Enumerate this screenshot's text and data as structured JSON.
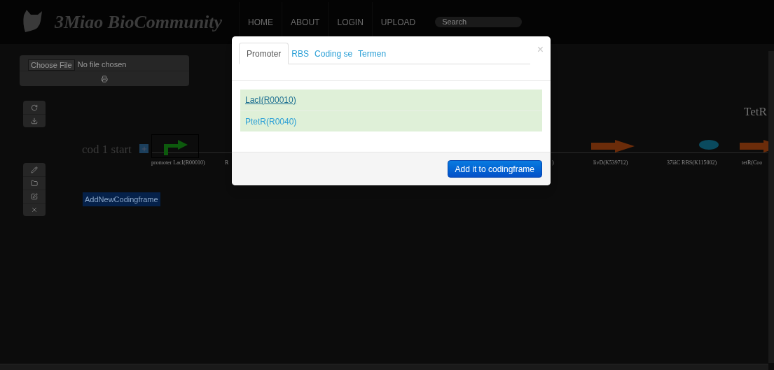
{
  "navbar": {
    "logo": "3Miao BioCommunity",
    "links": [
      "HOME",
      "ABOUT",
      "LOGIN",
      "UPLOAD"
    ],
    "search": {
      "placeholder": "Search"
    }
  },
  "file_panel": {
    "button": "Choose File",
    "status": "No file chosen"
  },
  "canvas": {
    "frame_title": "cod 1 start",
    "side_title": "TetR",
    "parts": [
      {
        "kind": "promoter",
        "label": "promoter LacI(R00010)"
      },
      {
        "kind": "label",
        "label": "R"
      },
      {
        "kind": "label",
        "label": ")"
      },
      {
        "kind": "cds",
        "label": "livD(K539712)"
      },
      {
        "kind": "rbs",
        "label": "37iâC RBS(K115002)"
      },
      {
        "kind": "cds",
        "label": "tetR(Coo"
      }
    ],
    "add_button": "AddNewCodingframe"
  },
  "modal": {
    "tabs": [
      {
        "label": "Promoter",
        "selected": true
      },
      {
        "label": "RBS",
        "selected": false
      },
      {
        "label": "Coding se",
        "selected": false
      },
      {
        "label": "Termen",
        "selected": false
      }
    ],
    "close": "×",
    "items": [
      {
        "label": "LacI(R00010)",
        "hovered": true
      },
      {
        "label": "PtetR(R0040)",
        "hovered": false
      }
    ],
    "button": "Add it to codingframe"
  }
}
